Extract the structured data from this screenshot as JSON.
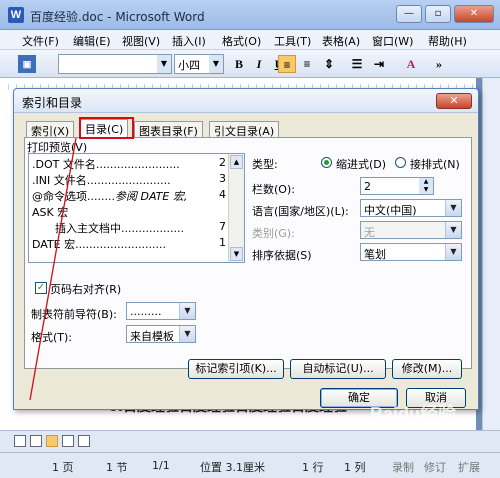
{
  "window": {
    "title": "百度经验.doc - Microsoft Word",
    "btn_min": "—",
    "btn_max": "▫",
    "btn_close": "✕"
  },
  "menu": [
    "文件(F)",
    "编辑(E)",
    "视图(V)",
    "插入(I)",
    "格式(O)",
    "工具(T)",
    "表格(A)",
    "窗口(W)",
    "帮助(H)"
  ],
  "toolbar": {
    "font_size": "小四",
    "bold": "B",
    "italic": "I",
    "underline": "U",
    "font_color": "A"
  },
  "document": {
    "visible_text": "6.百度经验百度经验百度经验百度经验"
  },
  "dialog": {
    "title": "索引和目录",
    "close": "✕",
    "tabs": [
      "索引(X)",
      "目录(C)",
      "图表目录(F)",
      "引文目录(A)"
    ],
    "active_tab": "目录(C)",
    "print_preview_label": "打印预览(V)",
    "preview_rows": [
      {
        "text": ".DOT 文件名",
        "dots": "........................",
        "page": "2"
      },
      {
        "text": ".INI 文件名",
        "dots": "........................",
        "page": "3"
      },
      {
        "text": "@命令选项",
        "dots": "........",
        "tail": "参阅 DATE 宏,",
        "page": "4"
      },
      {
        "text": "ASK 宏",
        "dots": "",
        "page": ""
      },
      {
        "text": "插入主文档中",
        "dots": "..................",
        "page": "7"
      },
      {
        "text": "DATE 宏",
        "dots": "..........................",
        "page": "1"
      }
    ],
    "type_label": "类型:",
    "type_options": [
      "缩进式(D)",
      "接排式(N)"
    ],
    "type_selected": "缩进式(D)",
    "columns_label": "栏数(O):",
    "columns_value": "2",
    "language_label": "语言(国家/地区)(L):",
    "language_value": "中文(中国)",
    "category_label": "类别(G):",
    "category_value": "无",
    "sort_label": "排序依据(S)",
    "sort_value": "笔划",
    "right_align_label": "页码右对齐(R)",
    "right_align_checked": true,
    "leader_label": "制表符前导符(B):",
    "leader_value": ".........",
    "format_label": "格式(T):",
    "format_value": "来自模板",
    "btn_mark_entry": "标记索引项(K)...",
    "btn_automark": "自动标记(U)...",
    "btn_modify": "修改(M)...",
    "btn_ok": "确定",
    "btn_cancel": "取消"
  },
  "status": {
    "page": "1 页",
    "section": "1 节",
    "pages": "1/1",
    "position": "位置 3.1厘米",
    "line": "1 行",
    "column": "1 列",
    "record": "录制",
    "revision": "修订",
    "extend": "扩展"
  },
  "watermark": "Baidu经验",
  "colors": {
    "highlight_box": "#d40c15",
    "dialog_bg": "#ece9d8",
    "radio_dot": "#21a121"
  }
}
